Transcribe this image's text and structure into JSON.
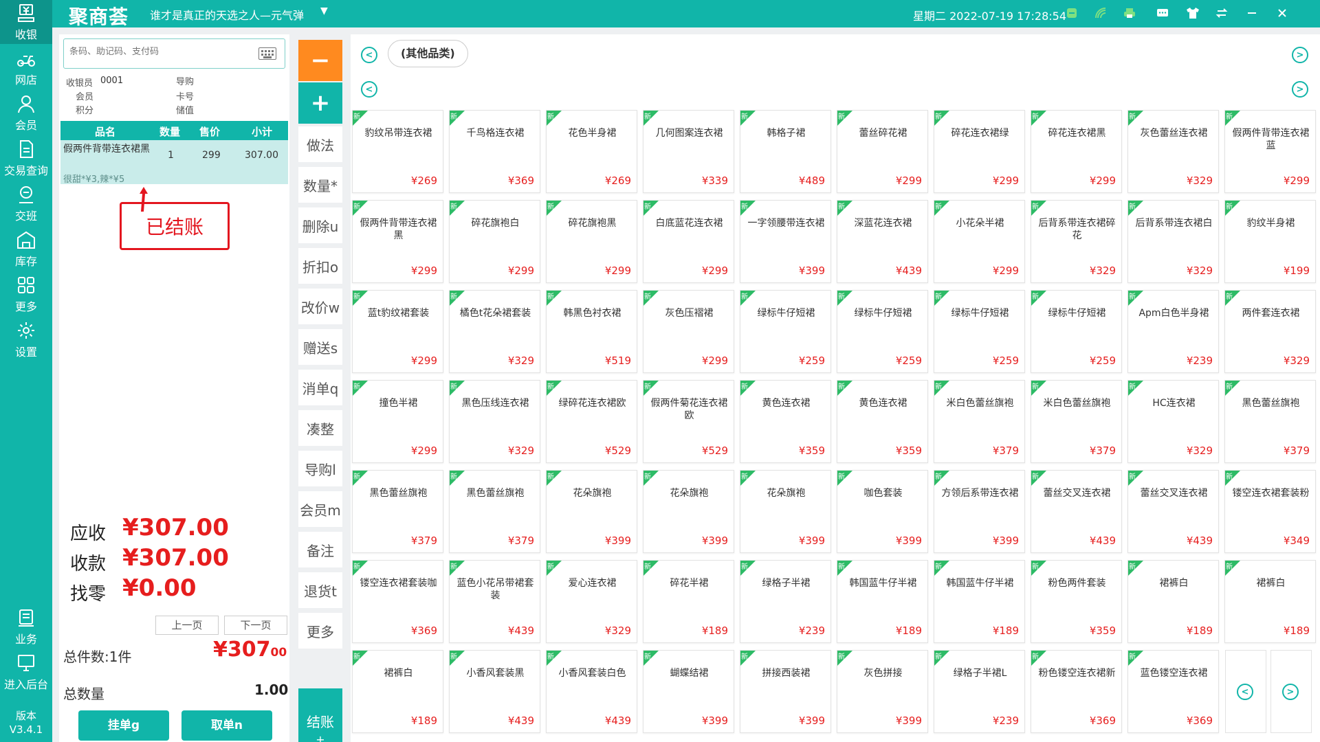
{
  "nav": {
    "items": [
      {
        "label": "收银",
        "icon": "cashier-icon"
      },
      {
        "label": "网店",
        "icon": "scooter-icon"
      },
      {
        "label": "会员",
        "icon": "user-icon"
      },
      {
        "label": "交易查询",
        "icon": "document-icon"
      },
      {
        "label": "交班",
        "icon": "shift-icon"
      },
      {
        "label": "库存",
        "icon": "warehouse-icon"
      },
      {
        "label": "更多",
        "icon": "grid-icon"
      },
      {
        "label": "设置",
        "icon": "gear-icon"
      }
    ],
    "bottom_items": [
      {
        "label": "业务",
        "icon": "business-icon"
      },
      {
        "label": "进入后台",
        "icon": "monitor-icon"
      }
    ],
    "version_label": "版本",
    "version": "V3.4.1"
  },
  "header": {
    "logo": "聚商荟",
    "store": "谁才是真正的天选之人—元气弹",
    "datetime": "星期二 2022-07-19 17:28:54",
    "colors": {
      "primary": "#11b5a9"
    }
  },
  "order": {
    "search_placeholder": "条码、助记码、支付码",
    "cashier_label": "收银员",
    "cashier_id": "0001",
    "guide_label": "导购",
    "member_label": "会员",
    "card_label": "卡号",
    "points_label": "积分",
    "balance_label": "储值",
    "columns": [
      "品名",
      "数量",
      "售价",
      "小计"
    ],
    "row": {
      "name": "假两件背带连衣裙黑",
      "qty": "1",
      "price": "299",
      "subtotal": "307.00",
      "note": "很甜*¥3,辣*¥5"
    },
    "stamp": "已结账",
    "receivable_label": "应收",
    "receivable": "¥307.00",
    "received_label": "收款",
    "received": "¥307.00",
    "change_label": "找零",
    "change": "¥0.00",
    "prev_page": "上一页",
    "next_page": "下一页",
    "total_items_label": "总件数:1件",
    "total_amount_main": "¥307",
    "total_amount_dec": "00",
    "total_qty_label": "总数量",
    "total_qty": "1.00",
    "hang_button": "挂单g",
    "take_button": "取单n"
  },
  "functions": {
    "minus": "−",
    "plus": "+",
    "buttons": [
      "做法",
      "数量*",
      "删除u",
      "折扣o",
      "改价w",
      "赠送s",
      "消单q",
      "凑整",
      "导购l",
      "会员m",
      "备注",
      "退货t",
      "更多"
    ],
    "checkout": "结账",
    "checkout_sub": "+",
    "colors": {
      "minus": "#ff8a1f",
      "plus": "#11b5a9"
    }
  },
  "products": {
    "category": "(其他品类)",
    "new_tag": "新",
    "items": [
      {
        "name": "豹纹吊带连衣裙",
        "price": "¥269"
      },
      {
        "name": "千鸟格连衣裙",
        "price": "¥369"
      },
      {
        "name": "花色半身裙",
        "price": "¥269"
      },
      {
        "name": "几何图案连衣裙",
        "price": "¥339"
      },
      {
        "name": "韩格子裙",
        "price": "¥489"
      },
      {
        "name": "蕾丝碎花裙",
        "price": "¥299"
      },
      {
        "name": "碎花连衣裙绿",
        "price": "¥299"
      },
      {
        "name": "碎花连衣裙黑",
        "price": "¥299"
      },
      {
        "name": "灰色蕾丝连衣裙",
        "price": "¥329"
      },
      {
        "name": "假两件背带连衣裙蓝",
        "price": "¥299"
      },
      {
        "name": "假两件背带连衣裙黑",
        "price": "¥299"
      },
      {
        "name": "碎花旗袍白",
        "price": "¥299"
      },
      {
        "name": "碎花旗袍黑",
        "price": "¥299"
      },
      {
        "name": "白底蓝花连衣裙",
        "price": "¥299"
      },
      {
        "name": "一字领腰带连衣裙",
        "price": "¥399"
      },
      {
        "name": "深蓝花连衣裙",
        "price": "¥439"
      },
      {
        "name": "小花朵半裙",
        "price": "¥299"
      },
      {
        "name": "后背系带连衣裙碎花",
        "price": "¥329"
      },
      {
        "name": "后背系带连衣裙白",
        "price": "¥329"
      },
      {
        "name": "豹纹半身裙",
        "price": "¥199"
      },
      {
        "name": "蓝t豹纹裙套装",
        "price": "¥299"
      },
      {
        "name": "橘色t花朵裙套装",
        "price": "¥329"
      },
      {
        "name": "韩黑色衬衣裙",
        "price": "¥519"
      },
      {
        "name": "灰色压褶裙",
        "price": "¥299"
      },
      {
        "name": "绿标牛仔短裙",
        "price": "¥259"
      },
      {
        "name": "绿标牛仔短裙",
        "price": "¥259"
      },
      {
        "name": "绿标牛仔短裙",
        "price": "¥259"
      },
      {
        "name": "绿标牛仔短裙",
        "price": "¥259"
      },
      {
        "name": "Apm白色半身裙",
        "price": "¥239"
      },
      {
        "name": "两件套连衣裙",
        "price": "¥329"
      },
      {
        "name": "撞色半裙",
        "price": "¥299"
      },
      {
        "name": "黑色压线连衣裙",
        "price": "¥329"
      },
      {
        "name": "绿碎花连衣裙欧",
        "price": "¥529"
      },
      {
        "name": "假两件菊花连衣裙欧",
        "price": "¥529"
      },
      {
        "name": "黄色连衣裙",
        "price": "¥359"
      },
      {
        "name": "黄色连衣裙",
        "price": "¥359"
      },
      {
        "name": "米白色蕾丝旗袍",
        "price": "¥379"
      },
      {
        "name": "米白色蕾丝旗袍",
        "price": "¥379"
      },
      {
        "name": "HC连衣裙",
        "price": "¥329"
      },
      {
        "name": "黑色蕾丝旗袍",
        "price": "¥379"
      },
      {
        "name": "黑色蕾丝旗袍",
        "price": "¥379"
      },
      {
        "name": "黑色蕾丝旗袍",
        "price": "¥379"
      },
      {
        "name": "花朵旗袍",
        "price": "¥399"
      },
      {
        "name": "花朵旗袍",
        "price": "¥399"
      },
      {
        "name": "花朵旗袍",
        "price": "¥399"
      },
      {
        "name": "咖色套装",
        "price": "¥399"
      },
      {
        "name": "方领后系带连衣裙",
        "price": "¥399"
      },
      {
        "name": "蕾丝交叉连衣裙",
        "price": "¥439"
      },
      {
        "name": "蕾丝交叉连衣裙",
        "price": "¥439"
      },
      {
        "name": "镂空连衣裙套装粉",
        "price": "¥349"
      },
      {
        "name": "镂空连衣裙套装咖",
        "price": "¥369"
      },
      {
        "name": "蓝色小花吊带裙套装",
        "price": "¥439"
      },
      {
        "name": "爱心连衣裙",
        "price": "¥329"
      },
      {
        "name": "碎花半裙",
        "price": "¥189"
      },
      {
        "name": "绿格子半裙",
        "price": "¥239"
      },
      {
        "name": "韩国蓝牛仔半裙",
        "price": "¥189"
      },
      {
        "name": "韩国蓝牛仔半裙",
        "price": "¥189"
      },
      {
        "name": "粉色两件套装",
        "price": "¥359"
      },
      {
        "name": "裙裤白",
        "price": "¥189"
      },
      {
        "name": "裙裤白",
        "price": "¥189"
      },
      {
        "name": "裙裤白",
        "price": "¥189"
      },
      {
        "name": "小香风套装黑",
        "price": "¥439"
      },
      {
        "name": "小香风套装白色",
        "price": "¥439"
      },
      {
        "name": "蝴蝶结裙",
        "price": "¥399"
      },
      {
        "name": "拼接西装裙",
        "price": "¥399"
      },
      {
        "name": "灰色拼接",
        "price": "¥399"
      },
      {
        "name": "绿格子半裙L",
        "price": "¥239"
      },
      {
        "name": "粉色镂空连衣裙新",
        "price": "¥369"
      },
      {
        "name": "蓝色镂空连衣裙",
        "price": "¥369"
      }
    ]
  }
}
